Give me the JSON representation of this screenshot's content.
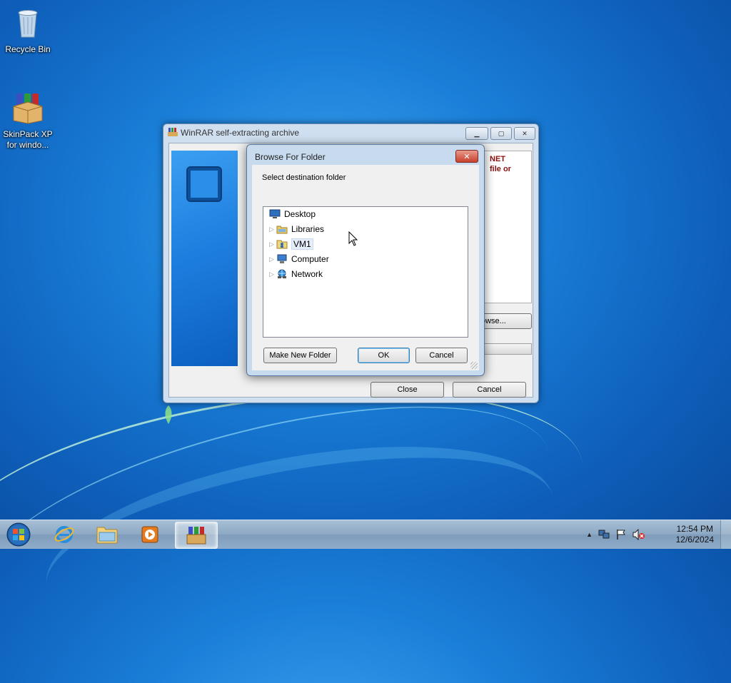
{
  "desktop": {
    "icons": [
      {
        "label": "Recycle Bin",
        "icon": "recycle-bin-icon"
      },
      {
        "label": "SkinPack XP\nfor windo...",
        "icon": "winrar-package-icon"
      }
    ]
  },
  "winrar_window": {
    "title": "WinRAR self-extracting archive",
    "info_text": "NET\nfile or",
    "browse_label": "owse...",
    "close_label": "Close",
    "cancel_label": "Cancel"
  },
  "browse_dialog": {
    "title": "Browse For Folder",
    "close_glyph": "✕",
    "prompt": "Select destination folder",
    "tree": [
      {
        "label": "Desktop",
        "icon": "desktop-icon"
      },
      {
        "label": "Libraries",
        "icon": "libraries-icon"
      },
      {
        "label": "VM1",
        "icon": "user-folder-icon"
      },
      {
        "label": "Computer",
        "icon": "computer-icon"
      },
      {
        "label": "Network",
        "icon": "network-icon"
      }
    ],
    "make_new_folder_label": "Make New Folder",
    "ok_label": "OK",
    "cancel_label": "Cancel"
  },
  "taskbar": {
    "pinned": [
      "internet-explorer-icon",
      "windows-explorer-icon",
      "media-player-icon",
      "winrar-icon"
    ],
    "clock_time": "12:54 PM",
    "clock_date": "12/6/2024",
    "tray_icons": [
      "show-hidden-icons-arrow",
      "network-tray-icon",
      "action-center-flag-icon",
      "volume-muted-icon"
    ]
  }
}
